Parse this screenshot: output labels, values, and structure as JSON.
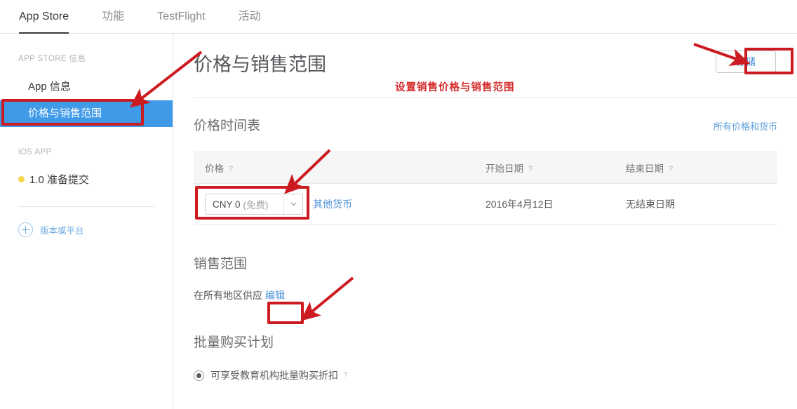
{
  "topnav": {
    "tabs": [
      {
        "label": "App Store",
        "active": true
      },
      {
        "label": "功能",
        "active": false
      },
      {
        "label": "TestFlight",
        "active": false
      },
      {
        "label": "活动",
        "active": false
      }
    ]
  },
  "sidebar": {
    "section1_title": "APP STORE 信息",
    "items": [
      {
        "label": "App 信息",
        "selected": false
      },
      {
        "label": "价格与销售范围",
        "selected": true
      }
    ],
    "section2_title": "iOS APP",
    "version": {
      "label": "1.0 准备提交",
      "status_color": "#f6d64a"
    },
    "add_link": {
      "label": "版本或平台",
      "icon": "plus-circle-icon"
    }
  },
  "header": {
    "title": "价格与销售范围",
    "save_label": "存储"
  },
  "price_section": {
    "title": "价格时间表",
    "all_prices_link": "所有价格和货币",
    "columns": [
      "价格",
      "开始日期",
      "结束日期"
    ],
    "help_glyph": "?",
    "row": {
      "price_value": "CNY 0",
      "price_suffix": "(免费)",
      "other_currency_link": "其他货币",
      "start_date": "2016年4月12日",
      "end_date": "无结束日期"
    }
  },
  "range_section": {
    "title": "销售范围",
    "availability": "在所有地区供应",
    "edit_link": "编辑"
  },
  "vpp_section": {
    "title": "批量购买计划",
    "option_label": "可享受教育机构批量购买折扣",
    "help_glyph": "?"
  },
  "annotations": {
    "callout_text": "设置销售价格与销售范围",
    "color": "#cc1b20"
  },
  "colors": {
    "accent_blue": "#3f9ae8",
    "link_blue": "#4a90d9",
    "annotation_red": "#cc1b20",
    "status_yellow": "#f6d64a"
  }
}
